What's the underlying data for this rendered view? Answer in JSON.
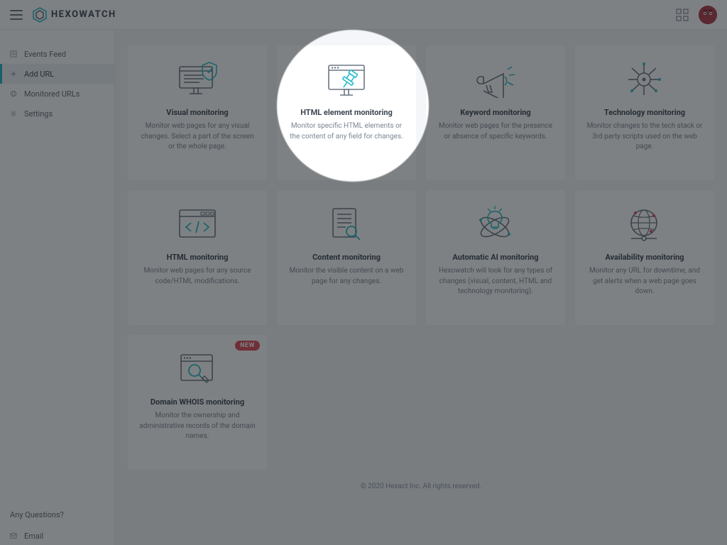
{
  "brand": "HEXOWATCH",
  "sidebar": {
    "items": [
      {
        "label": "Events Feed"
      },
      {
        "label": "Add URL"
      },
      {
        "label": "Monitored URLs"
      },
      {
        "label": "Settings"
      }
    ],
    "active_index": 1,
    "questions_heading": "Any Questions?",
    "email_label": "Email"
  },
  "cards": [
    {
      "title": "Visual monitoring",
      "desc": "Monitor web pages for any visual changes. Select a part of the screen or the whole page.",
      "icon": "monitor-shield",
      "new": false
    },
    {
      "title": "HTML element monitoring",
      "desc": "Monitor specific HTML elements or the content of any field for changes.",
      "icon": "monitor-pin",
      "new": false
    },
    {
      "title": "Keyword monitoring",
      "desc": "Monitor web pages for the presence or absence of specific keywords.",
      "icon": "megaphone",
      "new": false
    },
    {
      "title": "Technology monitoring",
      "desc": "Monitor changes to the tech stack or 3rd party scripts used on the web page.",
      "icon": "tech-node",
      "new": false
    },
    {
      "title": "HTML monitoring",
      "desc": "Monitor web pages for any source code/HTML modifications.",
      "icon": "code-window",
      "new": false
    },
    {
      "title": "Content monitoring",
      "desc": "Monitor the visible content on a web page for any changes.",
      "icon": "doc-search",
      "new": false
    },
    {
      "title": "Automatic AI monitoring",
      "desc": "Hexowatch will look for any types of changes (visual, content, HTML and technology monitoring).",
      "icon": "atom-bulb",
      "new": false
    },
    {
      "title": "Availability monitoring",
      "desc": "Monitor any URL for downtime, and get alerts when a web page goes down.",
      "icon": "globe-net",
      "new": false
    },
    {
      "title": "Domain WHOIS monitoring",
      "desc": "Monitor the ownership and administrative records of the domain names.",
      "icon": "browser-search",
      "new": true
    }
  ],
  "new_badge": "NEW",
  "footer": "© 2020 Hexact Inc. All rights reserved.",
  "colors": {
    "accent": "#28bccd",
    "danger": "#e14a5a",
    "ink": "#3b4652"
  },
  "spotlight_card_index": 1
}
